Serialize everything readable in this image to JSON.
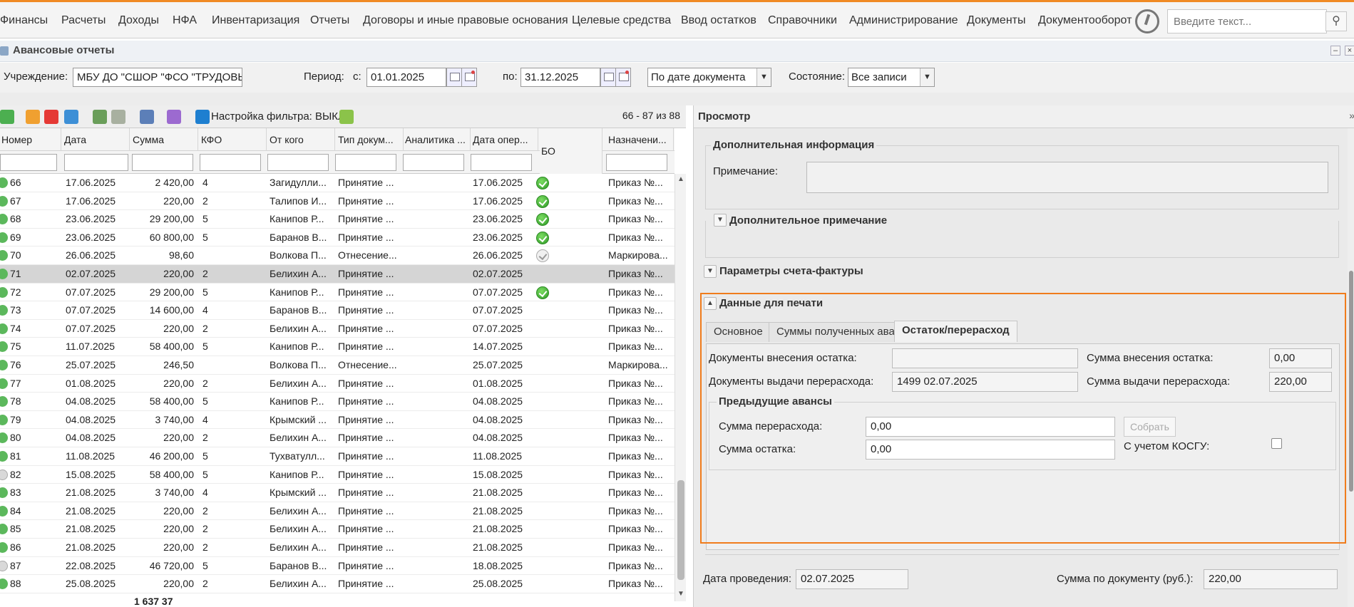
{
  "menu": [
    "Финансы",
    "Расчеты",
    "Доходы",
    "НФА",
    "Инвентаризация",
    "Отчеты",
    "Договоры и иные правовые основания",
    "Целевые средства",
    "Ввод остатков",
    "Справочники",
    "Администрирование",
    "Документы",
    "Документооборот"
  ],
  "search": {
    "placeholder": "Введите текст..."
  },
  "window": {
    "title": "Авансовые отчеты"
  },
  "filters": {
    "institution_label": "Учреждение:",
    "institution_value": "МБУ ДО \"СШОР \"ФСО \"ТРУДОВЫ",
    "period_label": "Период:",
    "from_label": "с:",
    "from_value": "01.01.2025",
    "to_label": "по:",
    "to_value": "31.12.2025",
    "date_mode": "По дате документа",
    "state_label": "Состояние:",
    "state_value": "Все записи"
  },
  "toolbar": {
    "filter_setting": "Настройка фильтра: ВЫКЛ",
    "count": "66 - 87 из 88"
  },
  "grid": {
    "columns": [
      "Номер",
      "Дата",
      "Сумма",
      "КФО",
      "От кого",
      "Тип докум...",
      "Аналитика ...",
      "Дата опер...",
      "БО",
      "Назначени..."
    ],
    "rows": [
      {
        "num": "66",
        "date": "17.06.2025",
        "sum": "2 420,00",
        "kfo": "4",
        "from": "Загидулли...",
        "type": "Принятие ...",
        "an": "",
        "op": "17.06.2025",
        "bo": "green",
        "purpose": "Приказ №..."
      },
      {
        "num": "67",
        "date": "17.06.2025",
        "sum": "220,00",
        "kfo": "2",
        "from": "Талипов И...",
        "type": "Принятие ...",
        "an": "",
        "op": "17.06.2025",
        "bo": "green",
        "purpose": "Приказ №..."
      },
      {
        "num": "68",
        "date": "23.06.2025",
        "sum": "29 200,00",
        "kfo": "5",
        "from": "Канипов Р...",
        "type": "Принятие ...",
        "an": "",
        "op": "23.06.2025",
        "bo": "green",
        "purpose": "Приказ №..."
      },
      {
        "num": "69",
        "date": "23.06.2025",
        "sum": "60 800,00",
        "kfo": "5",
        "from": "Баранов В...",
        "type": "Принятие ...",
        "an": "",
        "op": "23.06.2025",
        "bo": "green",
        "purpose": "Приказ №..."
      },
      {
        "num": "70",
        "date": "26.06.2025",
        "sum": "98,60",
        "kfo": "",
        "from": "Волкова П...",
        "type": "Отнесение...",
        "an": "",
        "op": "26.06.2025",
        "bo": "grey",
        "purpose": "Маркирова..."
      },
      {
        "num": "71",
        "date": "02.07.2025",
        "sum": "220,00",
        "kfo": "2",
        "from": "Белихин А...",
        "type": "Принятие ...",
        "an": "",
        "op": "02.07.2025",
        "bo": "",
        "purpose": "Приказ №...",
        "selected": true
      },
      {
        "num": "72",
        "date": "07.07.2025",
        "sum": "29 200,00",
        "kfo": "5",
        "from": "Канипов Р...",
        "type": "Принятие ...",
        "an": "",
        "op": "07.07.2025",
        "bo": "green",
        "purpose": "Приказ №..."
      },
      {
        "num": "73",
        "date": "07.07.2025",
        "sum": "14 600,00",
        "kfo": "4",
        "from": "Баранов В...",
        "type": "Принятие ...",
        "an": "",
        "op": "07.07.2025",
        "bo": "",
        "purpose": "Приказ №..."
      },
      {
        "num": "74",
        "date": "07.07.2025",
        "sum": "220,00",
        "kfo": "2",
        "from": "Белихин А...",
        "type": "Принятие ...",
        "an": "",
        "op": "07.07.2025",
        "bo": "",
        "purpose": "Приказ №..."
      },
      {
        "num": "75",
        "date": "11.07.2025",
        "sum": "58 400,00",
        "kfo": "5",
        "from": "Канипов Р...",
        "type": "Принятие ...",
        "an": "",
        "op": "14.07.2025",
        "bo": "",
        "purpose": "Приказ №..."
      },
      {
        "num": "76",
        "date": "25.07.2025",
        "sum": "246,50",
        "kfo": "",
        "from": "Волкова П...",
        "type": "Отнесение...",
        "an": "",
        "op": "25.07.2025",
        "bo": "",
        "purpose": "Маркирова..."
      },
      {
        "num": "77",
        "date": "01.08.2025",
        "sum": "220,00",
        "kfo": "2",
        "from": "Белихин А...",
        "type": "Принятие ...",
        "an": "",
        "op": "01.08.2025",
        "bo": "",
        "purpose": "Приказ №..."
      },
      {
        "num": "78",
        "date": "04.08.2025",
        "sum": "58 400,00",
        "kfo": "5",
        "from": "Канипов Р...",
        "type": "Принятие ...",
        "an": "",
        "op": "04.08.2025",
        "bo": "",
        "purpose": "Приказ №..."
      },
      {
        "num": "79",
        "date": "04.08.2025",
        "sum": "3 740,00",
        "kfo": "4",
        "from": "Крымский ...",
        "type": "Принятие ...",
        "an": "",
        "op": "04.08.2025",
        "bo": "",
        "purpose": "Приказ №..."
      },
      {
        "num": "80",
        "date": "04.08.2025",
        "sum": "220,00",
        "kfo": "2",
        "from": "Белихин А...",
        "type": "Принятие ...",
        "an": "",
        "op": "04.08.2025",
        "bo": "",
        "purpose": "Приказ №..."
      },
      {
        "num": "81",
        "date": "11.08.2025",
        "sum": "46 200,00",
        "kfo": "5",
        "from": "Тухватулл...",
        "type": "Принятие ...",
        "an": "",
        "op": "11.08.2025",
        "bo": "",
        "purpose": "Приказ №..."
      },
      {
        "num": "82",
        "date": "15.08.2025",
        "sum": "58 400,00",
        "kfo": "5",
        "from": "Канипов Р...",
        "type": "Принятие ...",
        "an": "",
        "op": "15.08.2025",
        "bo": "",
        "purpose": "Приказ №...",
        "status": "grey"
      },
      {
        "num": "83",
        "date": "21.08.2025",
        "sum": "3 740,00",
        "kfo": "4",
        "from": "Крымский ...",
        "type": "Принятие ...",
        "an": "",
        "op": "21.08.2025",
        "bo": "",
        "purpose": "Приказ №..."
      },
      {
        "num": "84",
        "date": "21.08.2025",
        "sum": "220,00",
        "kfo": "2",
        "from": "Белихин А...",
        "type": "Принятие ...",
        "an": "",
        "op": "21.08.2025",
        "bo": "",
        "purpose": "Приказ №..."
      },
      {
        "num": "85",
        "date": "21.08.2025",
        "sum": "220,00",
        "kfo": "2",
        "from": "Белихин А...",
        "type": "Принятие ...",
        "an": "",
        "op": "21.08.2025",
        "bo": "",
        "purpose": "Приказ №..."
      },
      {
        "num": "86",
        "date": "21.08.2025",
        "sum": "220,00",
        "kfo": "2",
        "from": "Белихин А...",
        "type": "Принятие ...",
        "an": "",
        "op": "21.08.2025",
        "bo": "",
        "purpose": "Приказ №..."
      },
      {
        "num": "87",
        "date": "22.08.2025",
        "sum": "46 720,00",
        "kfo": "5",
        "from": "Баранов В...",
        "type": "Принятие ...",
        "an": "",
        "op": "18.08.2025",
        "bo": "",
        "purpose": "Приказ №...",
        "status": "grey"
      },
      {
        "num": "88",
        "date": "25.08.2025",
        "sum": "220,00",
        "kfo": "2",
        "from": "Белихин А...",
        "type": "Принятие ...",
        "an": "",
        "op": "25.08.2025",
        "bo": "",
        "purpose": "Приказ №..."
      }
    ],
    "total": "1 637 37"
  },
  "preview": {
    "title": "Просмотр",
    "extra_info": {
      "title": "Дополнительная информация",
      "note_label": "Примечание:"
    },
    "extra_note_title": "Дополнительное примечание",
    "invoice_params_title": "Параметры счета-фактуры",
    "print_data": {
      "title": "Данные для печати",
      "tabs": [
        "Основное",
        "Суммы полученных авансов",
        "Остаток/перерасход"
      ],
      "active_tab": "Остаток/перерасход",
      "docs_remainder_label": "Документы внесения остатка:",
      "docs_remainder_value": "",
      "sum_remainder_label": "Сумма внесения остатка:",
      "sum_remainder_value": "0,00",
      "docs_overspend_label": "Документы выдачи перерасхода:",
      "docs_overspend_value": "1499 02.07.2025",
      "sum_overspend_label": "Сумма выдачи перерасхода:",
      "sum_overspend_value": "220,00",
      "prev_title": "Предыдущие авансы",
      "prev_overspend_label": "Сумма перерасхода:",
      "prev_overspend_value": "0,00",
      "prev_remainder_label": "Сумма остатка:",
      "prev_remainder_value": "0,00",
      "collect_button": "Собрать",
      "kosgu_label": "С учетом КОСГУ:"
    },
    "posting_date_label": "Дата проведения:",
    "posting_date_value": "02.07.2025",
    "doc_sum_label": "Сумма по документу (руб.):",
    "doc_sum_value": "220,00"
  }
}
